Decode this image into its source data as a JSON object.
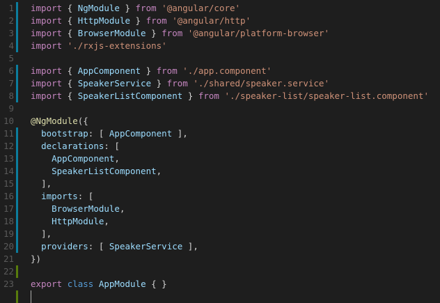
{
  "colors": {
    "background": "#1e1e1e",
    "line_number": "#5a5a5a",
    "modified_marker": "#0c7d9d",
    "added_marker": "#587c0c",
    "keyword": "#c586c0",
    "storage": "#569cd6",
    "identifier": "#9cdcfe",
    "string": "#ce9178",
    "decorator": "#dcdcaa",
    "punctuation": "#d4d4d4"
  },
  "editor": {
    "lines": [
      {
        "number": "1",
        "marker": "modified",
        "tokens": [
          {
            "t": "import",
            "c": "keyword"
          },
          {
            "t": " { ",
            "c": "punct"
          },
          {
            "t": "NgModule",
            "c": "ident"
          },
          {
            "t": " } ",
            "c": "punct"
          },
          {
            "t": "from",
            "c": "keyword"
          },
          {
            "t": " ",
            "c": "punct"
          },
          {
            "t": "'@angular/core'",
            "c": "string"
          }
        ]
      },
      {
        "number": "2",
        "marker": "modified",
        "tokens": [
          {
            "t": "import",
            "c": "keyword"
          },
          {
            "t": " { ",
            "c": "punct"
          },
          {
            "t": "HttpModule",
            "c": "ident"
          },
          {
            "t": " } ",
            "c": "punct"
          },
          {
            "t": "from",
            "c": "keyword"
          },
          {
            "t": " ",
            "c": "punct"
          },
          {
            "t": "'@angular/http'",
            "c": "string"
          }
        ]
      },
      {
        "number": "3",
        "marker": "modified",
        "tokens": [
          {
            "t": "import",
            "c": "keyword"
          },
          {
            "t": " { ",
            "c": "punct"
          },
          {
            "t": "BrowserModule",
            "c": "ident"
          },
          {
            "t": " } ",
            "c": "punct"
          },
          {
            "t": "from",
            "c": "keyword"
          },
          {
            "t": " ",
            "c": "punct"
          },
          {
            "t": "'@angular/platform-browser'",
            "c": "string"
          }
        ]
      },
      {
        "number": "4",
        "marker": "modified",
        "tokens": [
          {
            "t": "import",
            "c": "keyword"
          },
          {
            "t": " ",
            "c": "punct"
          },
          {
            "t": "'./rxjs-extensions'",
            "c": "string"
          }
        ]
      },
      {
        "number": "5",
        "marker": "none",
        "tokens": []
      },
      {
        "number": "6",
        "marker": "modified",
        "tokens": [
          {
            "t": "import",
            "c": "keyword"
          },
          {
            "t": " { ",
            "c": "punct"
          },
          {
            "t": "AppComponent",
            "c": "ident"
          },
          {
            "t": " } ",
            "c": "punct"
          },
          {
            "t": "from",
            "c": "keyword"
          },
          {
            "t": " ",
            "c": "punct"
          },
          {
            "t": "'./app.component'",
            "c": "string"
          }
        ]
      },
      {
        "number": "7",
        "marker": "modified",
        "tokens": [
          {
            "t": "import",
            "c": "keyword"
          },
          {
            "t": " { ",
            "c": "punct"
          },
          {
            "t": "SpeakerService",
            "c": "ident"
          },
          {
            "t": " } ",
            "c": "punct"
          },
          {
            "t": "from",
            "c": "keyword"
          },
          {
            "t": " ",
            "c": "punct"
          },
          {
            "t": "'./shared/speaker.service'",
            "c": "string"
          }
        ]
      },
      {
        "number": "8",
        "marker": "modified",
        "tokens": [
          {
            "t": "import",
            "c": "keyword"
          },
          {
            "t": " { ",
            "c": "punct"
          },
          {
            "t": "SpeakerListComponent",
            "c": "ident"
          },
          {
            "t": " } ",
            "c": "punct"
          },
          {
            "t": "from",
            "c": "keyword"
          },
          {
            "t": " ",
            "c": "punct"
          },
          {
            "t": "'./speaker-list/speaker-list.component'",
            "c": "string"
          }
        ]
      },
      {
        "number": "9",
        "marker": "none",
        "tokens": []
      },
      {
        "number": "10",
        "marker": "none",
        "tokens": [
          {
            "t": "@NgModule",
            "c": "decorator"
          },
          {
            "t": "({",
            "c": "punct"
          }
        ]
      },
      {
        "number": "11",
        "marker": "modified",
        "tokens": [
          {
            "t": "  ",
            "c": "punct"
          },
          {
            "t": "bootstrap",
            "c": "ident"
          },
          {
            "t": ": [ ",
            "c": "punct"
          },
          {
            "t": "AppComponent",
            "c": "ident"
          },
          {
            "t": " ],",
            "c": "punct"
          }
        ]
      },
      {
        "number": "12",
        "marker": "modified",
        "tokens": [
          {
            "t": "  ",
            "c": "punct"
          },
          {
            "t": "declarations",
            "c": "ident"
          },
          {
            "t": ": [",
            "c": "punct"
          }
        ]
      },
      {
        "number": "13",
        "marker": "modified",
        "tokens": [
          {
            "t": "    ",
            "c": "punct"
          },
          {
            "t": "AppComponent",
            "c": "ident"
          },
          {
            "t": ",",
            "c": "punct"
          }
        ]
      },
      {
        "number": "14",
        "marker": "modified",
        "tokens": [
          {
            "t": "    ",
            "c": "punct"
          },
          {
            "t": "SpeakerListComponent",
            "c": "ident"
          },
          {
            "t": ",",
            "c": "punct"
          }
        ]
      },
      {
        "number": "15",
        "marker": "modified",
        "tokens": [
          {
            "t": "  ",
            "c": "punct"
          },
          {
            "t": "],",
            "c": "punct"
          }
        ]
      },
      {
        "number": "16",
        "marker": "modified",
        "tokens": [
          {
            "t": "  ",
            "c": "punct"
          },
          {
            "t": "imports",
            "c": "ident"
          },
          {
            "t": ": [",
            "c": "punct"
          }
        ]
      },
      {
        "number": "17",
        "marker": "modified",
        "tokens": [
          {
            "t": "    ",
            "c": "punct"
          },
          {
            "t": "BrowserModule",
            "c": "ident"
          },
          {
            "t": ",",
            "c": "punct"
          }
        ]
      },
      {
        "number": "18",
        "marker": "modified",
        "tokens": [
          {
            "t": "    ",
            "c": "punct"
          },
          {
            "t": "HttpModule",
            "c": "ident"
          },
          {
            "t": ",",
            "c": "punct"
          }
        ]
      },
      {
        "number": "19",
        "marker": "modified",
        "tokens": [
          {
            "t": "  ",
            "c": "punct"
          },
          {
            "t": "],",
            "c": "punct"
          }
        ]
      },
      {
        "number": "20",
        "marker": "modified",
        "tokens": [
          {
            "t": "  ",
            "c": "punct"
          },
          {
            "t": "providers",
            "c": "ident"
          },
          {
            "t": ": [ ",
            "c": "punct"
          },
          {
            "t": "SpeakerService",
            "c": "ident"
          },
          {
            "t": " ],",
            "c": "punct"
          }
        ]
      },
      {
        "number": "21",
        "marker": "none",
        "tokens": [
          {
            "t": "})",
            "c": "punct"
          }
        ]
      },
      {
        "number": "22",
        "marker": "added",
        "tokens": []
      },
      {
        "number": "23",
        "marker": "none",
        "tokens": [
          {
            "t": "export",
            "c": "keyword"
          },
          {
            "t": " ",
            "c": "punct"
          },
          {
            "t": "class",
            "c": "storage"
          },
          {
            "t": " ",
            "c": "punct"
          },
          {
            "t": "AppModule",
            "c": "ident"
          },
          {
            "t": " { }",
            "c": "punct"
          }
        ]
      },
      {
        "number": "",
        "marker": "added",
        "tokens": []
      }
    ]
  }
}
